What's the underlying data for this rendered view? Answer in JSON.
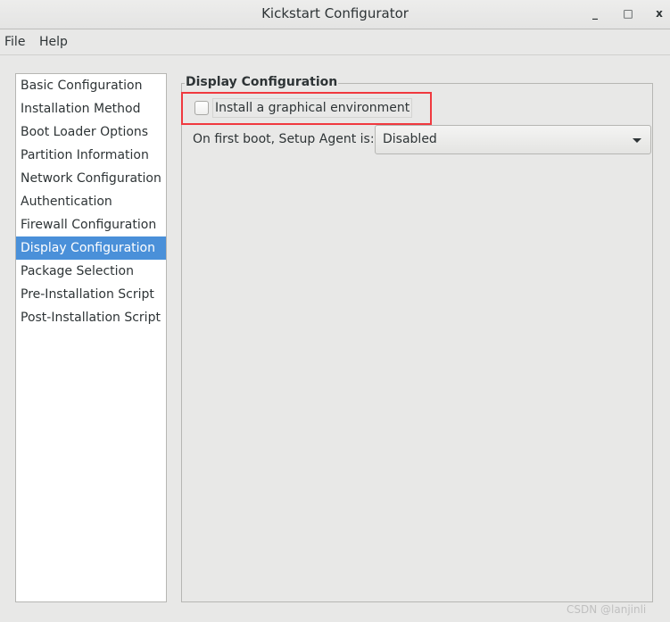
{
  "window": {
    "title": "Kickstart Configurator",
    "minimize": "_",
    "maximize": "□",
    "close": "x"
  },
  "menu": [
    "File",
    "Help"
  ],
  "sidebar": {
    "items": [
      "Basic Configuration",
      "Installation Method",
      "Boot Loader Options",
      "Partition Information",
      "Network Configuration",
      "Authentication",
      "Firewall Configuration",
      "Display Configuration",
      "Package Selection",
      "Pre-Installation Script",
      "Post-Installation Script"
    ],
    "selected": "Display Configuration"
  },
  "panel": {
    "title": "Display Configuration",
    "checkbox_label": "Install a graphical environment",
    "checkbox_checked": false,
    "setup_agent_label": "On first boot, Setup Agent is:",
    "setup_agent_value": "Disabled"
  },
  "colors": {
    "selection": "#4a90d9",
    "highlight_box": "#f0393f"
  },
  "watermark": "CSDN @lanjinli"
}
